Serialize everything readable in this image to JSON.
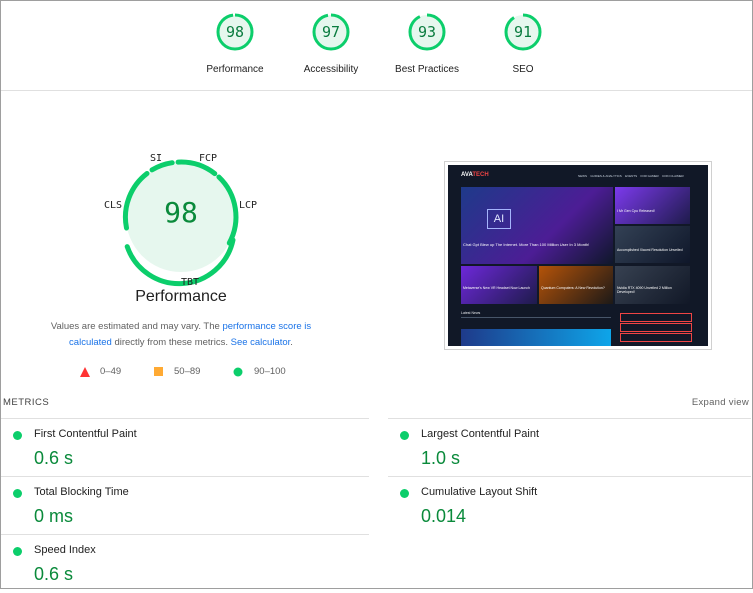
{
  "scores": [
    {
      "label": "Performance",
      "value": "98"
    },
    {
      "label": "Accessibility",
      "value": "97"
    },
    {
      "label": "Best Practices",
      "value": "93"
    },
    {
      "label": "SEO",
      "value": "91"
    }
  ],
  "main_gauge": {
    "value": "98",
    "title": "Performance",
    "segments": {
      "si": "SI",
      "fcp": "FCP",
      "lcp": "LCP",
      "tbt": "TBT",
      "cls": "CLS"
    }
  },
  "note": {
    "prefix": "Values are estimated and may vary. The ",
    "link1": "performance score is calculated",
    "middle": " directly from these metrics. ",
    "link2": "See calculator",
    "suffix": "."
  },
  "legend": [
    {
      "range": "0–49",
      "color": "#ff3333"
    },
    {
      "range": "50–89",
      "color": "#ffaa33"
    },
    {
      "range": "90–100",
      "color": "#0cce6b"
    }
  ],
  "screenshot": {
    "logo_a": "AVA",
    "logo_b": "TECH",
    "nav": [
      "NEWS",
      "GUIDES & ANALYTICS",
      "EVENTS",
      "FOR GAMER",
      "COIN CLAIMER"
    ],
    "hero_title": "Chat Gpt Blew up The Internet. More Than 100 Million User In 3 Month!",
    "side_title": "I Mr Gen Cpu Released!",
    "side_title2": "Accomplished Xiaomi Resolution Unveiled",
    "card1": "Metaverse's New VR Headset Now Launch",
    "card2": "Quantum Computers: A New Revolution?",
    "card3": "Nvidia RTX 4090 Unveiled 2 Million Developed!",
    "section": "Latest News",
    "ai_label": "AI"
  },
  "metrics_header": "METRICS",
  "expand_label": "Expand view",
  "metrics": [
    {
      "name": "First Contentful Paint",
      "value": "0.6 s"
    },
    {
      "name": "Largest Contentful Paint",
      "value": "1.0 s"
    },
    {
      "name": "Total Blocking Time",
      "value": "0 ms"
    },
    {
      "name": "Cumulative Layout Shift",
      "value": "0.014"
    },
    {
      "name": "Speed Index",
      "value": "0.6 s"
    }
  ],
  "colors": {
    "pass": "#0cce6b",
    "pass_text": "#0a8a3b",
    "gauge_fill": "#e6f7ee",
    "link": "#1a73e8"
  }
}
